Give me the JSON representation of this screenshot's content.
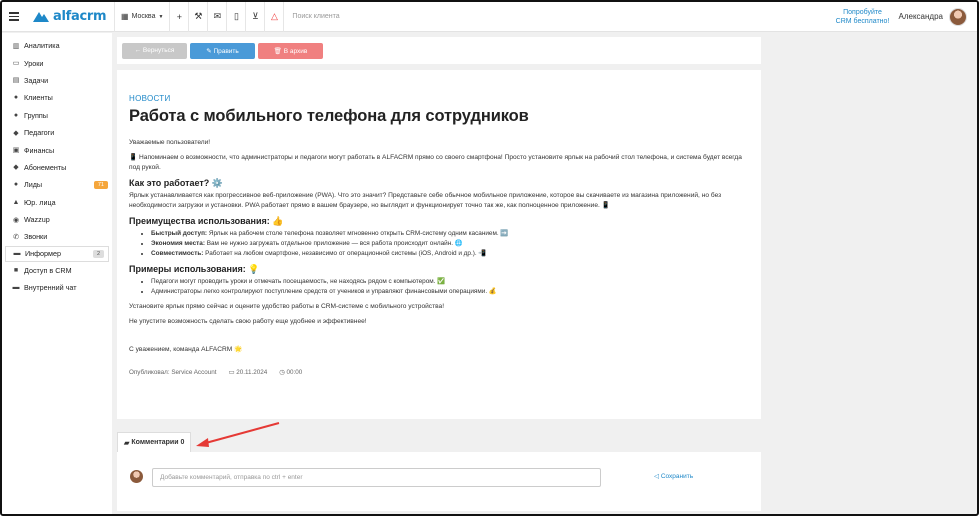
{
  "header": {
    "branch": "Москва",
    "logo_text": "alfacrm",
    "search_placeholder": "Поиск клиента",
    "promo_line1": "Попробуйте",
    "promo_line2": "CRM бесплатно!",
    "user_name": "Александра",
    "icons": [
      "menu-icon",
      "building-icon",
      "plus-icon",
      "wrench-icon",
      "mail-icon",
      "mobile-icon",
      "cart-icon",
      "bell-icon"
    ]
  },
  "sidebar": {
    "items": [
      {
        "label": "Аналитика",
        "icon": "chart-icon"
      },
      {
        "label": "Уроки",
        "icon": "calendar-icon"
      },
      {
        "label": "Задачи",
        "icon": "tasks-icon"
      },
      {
        "label": "Клиенты",
        "icon": "user-icon"
      },
      {
        "label": "Группы",
        "icon": "users-icon"
      },
      {
        "label": "Педагоги",
        "icon": "graduation-icon"
      },
      {
        "label": "Финансы",
        "icon": "money-icon"
      },
      {
        "label": "Абонементы",
        "icon": "tag-icon"
      },
      {
        "label": "Лиды",
        "icon": "user-plus-icon",
        "badge": "71"
      },
      {
        "label": "Юр. лица",
        "icon": "bank-icon"
      },
      {
        "label": "Wazzup",
        "icon": "chat-icon"
      },
      {
        "label": "Звонки",
        "icon": "phone-icon"
      },
      {
        "label": "Информер",
        "icon": "inbox-icon",
        "badge": "2"
      },
      {
        "label": "Доступ в CRM",
        "icon": "lock-icon"
      },
      {
        "label": "Внутренний чат",
        "icon": "message-icon"
      }
    ]
  },
  "toolbar": {
    "back_label": "← Вернуться",
    "edit_label": "✎ Править",
    "archive_label": "🗑 В архив"
  },
  "article": {
    "kicker": "НОВОСТИ",
    "title": "Работа с мобильного телефона для сотрудников",
    "greeting": "Уважаемые пользователи!",
    "intro": "📱 Напоминаем о возможности, что администраторы и педагоги могут работать в ALFACRM прямо со своего смартфона! Просто установите ярлык на рабочий стол телефона, и система будет всегда под рукой.",
    "how_heading": "Как это работает? ⚙️",
    "how_text": "Ярлык устанавливается как прогрессивное веб-приложение (PWA). Что это значит? Представьте себе обычное мобильное приложение, которое вы скачиваете из магазина приложений, но без необходимости загрузки и установки. PWA работает прямо в вашем браузере, но выглядит и функционирует точно так же, как полноценное приложение. 📱",
    "benefits_heading": "Преимущества использования: 👍",
    "benefits": [
      {
        "bold": "Быстрый доступ:",
        "text": " Ярлык на рабочем столе телефона позволяет мгновенно открыть CRM-систему одним касанием. ➡️"
      },
      {
        "bold": "Экономия места:",
        "text": " Вам не нужно загружать отдельное приложение — вся работа происходит онлайн. 🌐"
      },
      {
        "bold": "Совместимость:",
        "text": " Работает на любом смартфоне, независимо от операционной системы (iOS, Android и др.). 📲"
      }
    ],
    "examples_heading": "Примеры использования: 💡",
    "examples": [
      "Педагоги могут проводить уроки и отмечать посещаемость, не находясь рядом с компьютером. ✅",
      "Администраторы легко контролируют поступление средств от учеников и управляют финансовыми операциями. 💰"
    ],
    "cta1": "Установите ярлык прямо сейчас и оцените удобство работы в CRM-системе с мобильного устройства!",
    "cta2": "Не упустите возможность сделать свою работу еще удобнее и эффективнее!",
    "signature": "С уважением, команда ALFACRM 🌟",
    "published_by": "Опубликовал: Service Account",
    "date": "20.11.2024",
    "time": "00:00"
  },
  "comments": {
    "tab_label": "Комментарии 0",
    "placeholder": "Добавьте комментарий, отправка по ctrl + enter",
    "save_label": "Сохранить"
  },
  "colors": {
    "brand": "#1e88c8",
    "edit_button": "#4a9ad8",
    "archive_button": "#f08080",
    "back_button": "#c8c8c8",
    "annotation_arrow": "#e53935"
  }
}
